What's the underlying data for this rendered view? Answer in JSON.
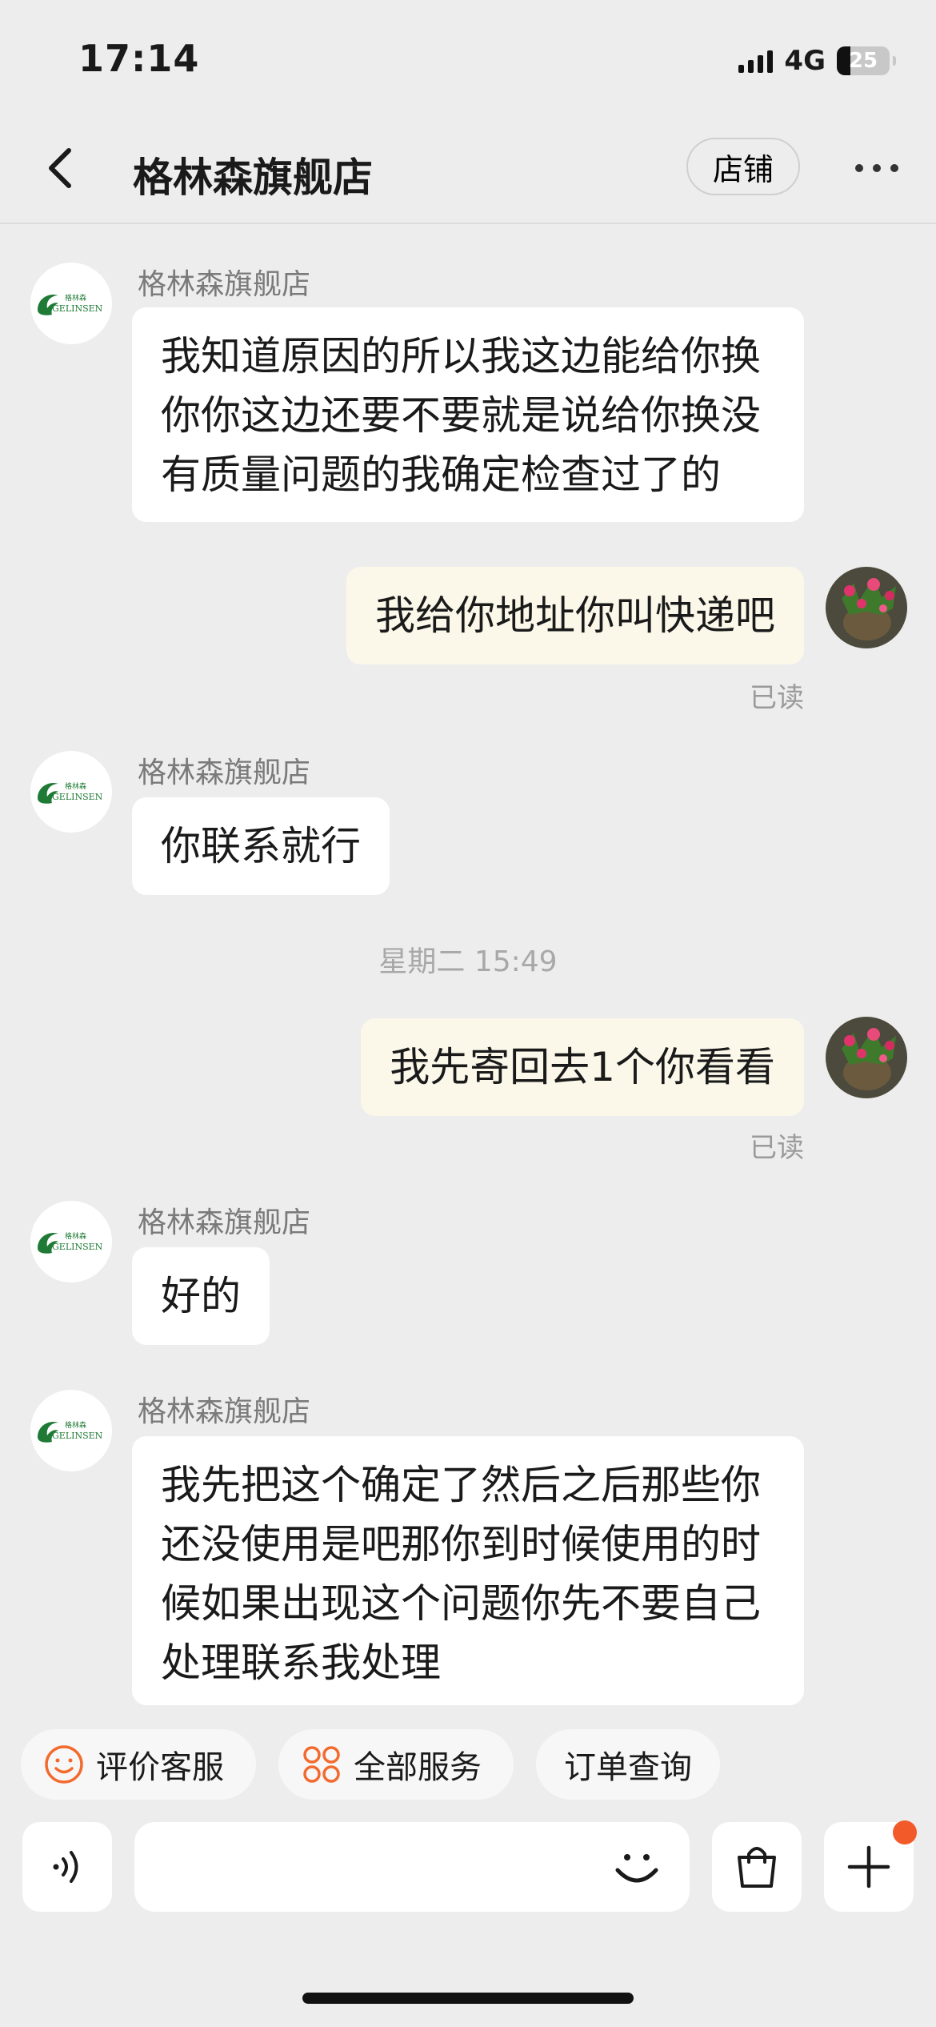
{
  "status_bar": {
    "time": "17:14",
    "network": "4G",
    "battery": "25"
  },
  "nav": {
    "title": "格林森旗舰店",
    "shop_button": "店铺"
  },
  "store": {
    "logo_text": "格林森",
    "logo_brand": "GELINSEN",
    "brand_color": "#1e7a34"
  },
  "messages": {
    "m1": {
      "sender": "格林森旗舰店",
      "lines": [
        "我知道原因的所以我这边能给你换",
        "你你这边还要不要就是说给你换没",
        "有质量问题的我确定检查过了的"
      ]
    },
    "m2": {
      "text": "我给你地址你叫快递吧",
      "receipt": "已读"
    },
    "m3": {
      "sender": "格林森旗舰店",
      "text": "你联系就行"
    },
    "divider": "星期二 15:49",
    "m4": {
      "text": "我先寄回去1个你看看",
      "receipt": "已读"
    },
    "m5": {
      "sender": "格林森旗舰店",
      "text": "好的"
    },
    "m6": {
      "sender": "格林森旗舰店",
      "lines": [
        "我先把这个确定了然后之后那些你",
        "还没使用是吧那你到时候使用的时",
        "候如果出现这个问题你先不要自己",
        "处理联系我处理"
      ]
    }
  },
  "quick_actions": {
    "rate": "评价客服",
    "all_services": "全部服务",
    "order_query": "订单查询",
    "accent_color": "#f26a2e"
  },
  "input": {
    "placeholder": ""
  },
  "colors": {
    "background": "#ededed",
    "incoming_bubble": "#ffffff",
    "outgoing_bubble": "#fbf8ea",
    "badge": "#f25a2a"
  },
  "icons": [
    "back-icon",
    "more-icon",
    "voice-icon",
    "emoji-icon",
    "shopping-bag-icon",
    "plus-icon",
    "smile-icon",
    "services-grid-icon"
  ]
}
